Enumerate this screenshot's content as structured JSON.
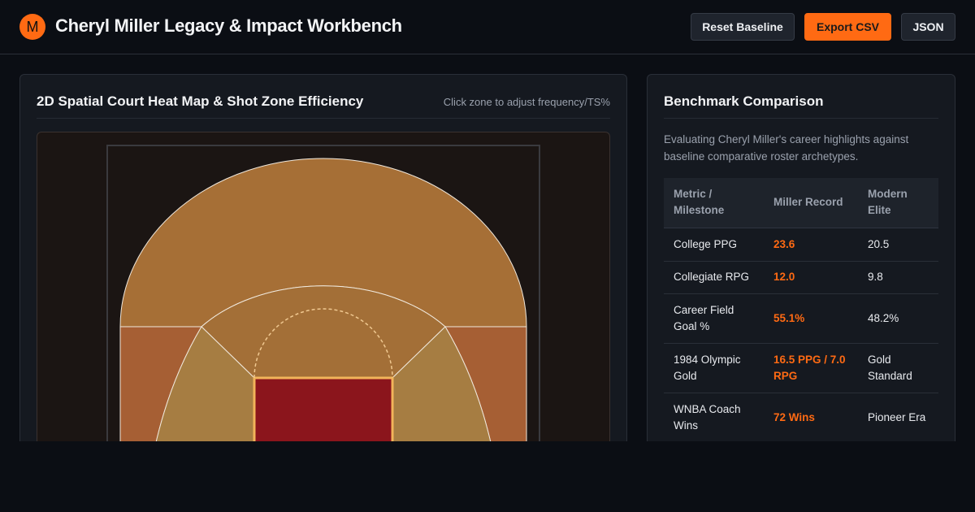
{
  "header": {
    "logo_letter": "M",
    "title": "Cheryl Miller Legacy & Impact Workbench",
    "buttons": {
      "reset": "Reset Baseline",
      "export_csv": "Export CSV",
      "json": "JSON"
    }
  },
  "court_panel": {
    "title": "2D Spatial Court Heat Map & Shot Zone Efficiency",
    "hint": "Click zone to adjust frequency/TS%",
    "zone_colors": {
      "above_break_three": "#a66f36",
      "corner_three": "#a65f34",
      "mid_range_top": "#a36f37",
      "mid_range_wing": "#a67d42",
      "paint": "#8b151c"
    }
  },
  "benchmark_panel": {
    "title": "Benchmark Comparison",
    "description": "Evaluating Cheryl Miller's career highlights against baseline comparative roster archetypes.",
    "columns": [
      "Metric / Milestone",
      "Miller Record",
      "Modern Elite"
    ],
    "rows": [
      {
        "metric": "College PPG",
        "miller": "23.6",
        "elite": "20.5"
      },
      {
        "metric": "Collegiate RPG",
        "miller": "12.0",
        "elite": "9.8"
      },
      {
        "metric": "Career Field Goal %",
        "miller": "55.1%",
        "elite": "48.2%"
      },
      {
        "metric": "1984 Olympic Gold",
        "miller": "16.5 PPG / 7.0 RPG",
        "elite": "Gold Standard"
      },
      {
        "metric": "WNBA Coach Wins",
        "miller": "72 Wins",
        "elite": "Pioneer Era"
      }
    ],
    "accent_color": "#ff6a13"
  }
}
